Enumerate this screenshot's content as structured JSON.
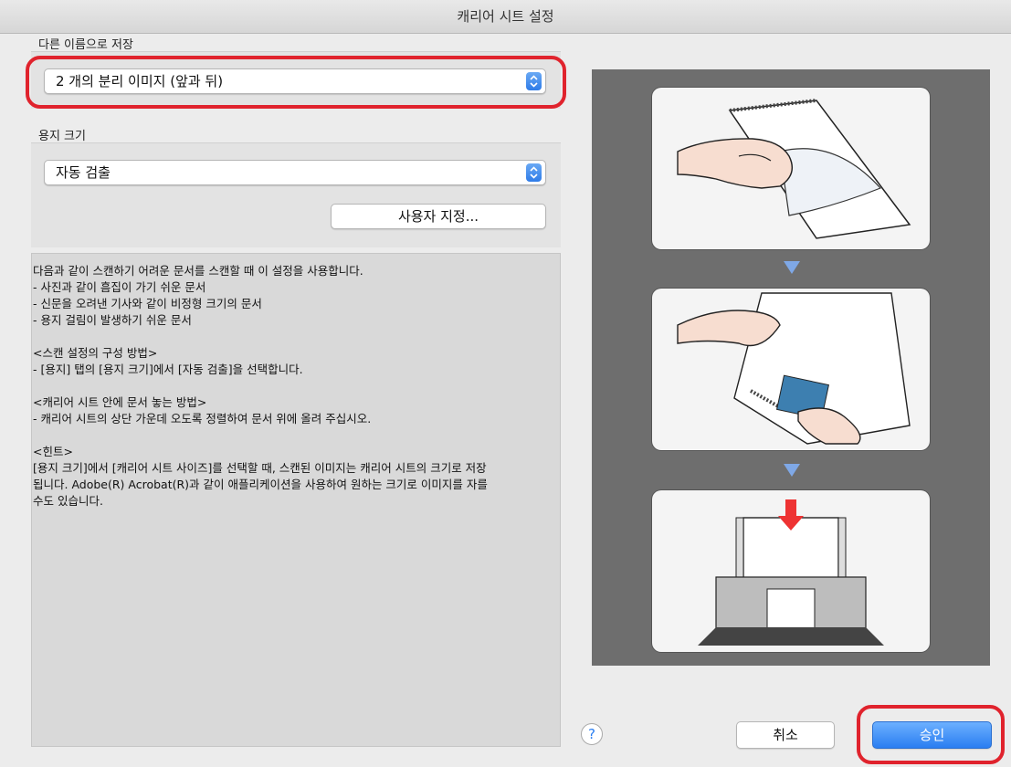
{
  "window": {
    "title": "캐리어 시트 설정"
  },
  "save_as": {
    "label": "다른 이름으로 저장",
    "selected": "2 개의 분리 이미지 (앞과 뒤)"
  },
  "paper_size": {
    "label": "용지 크기",
    "selected": "자동 검출",
    "custom_button": "사용자 지정..."
  },
  "description": {
    "lines": [
      "다음과 같이 스캔하기 어려운 문서를 스캔할 때 이 설정을 사용합니다.",
      "- 사진과 같이 흠집이 가기 쉬운 문서",
      "- 신문을 오려낸 기사와 같이 비정형 크기의 문서",
      "- 용지 걸림이 발생하기 쉬운 문서",
      "",
      "<스캔 설정의 구성 방법>",
      "- [용지] 탭의 [용지 크기]에서 [자동 검출]을 선택합니다.",
      "",
      "<캐리어 시트 안에 문서 놓는 방법>",
      "- 캐리어 시트의 상단 가운데 오도록 정렬하여 문서 위에 올려 주십시오.",
      "",
      "<힌트>",
      "[용지 크기]에서 [캐리어 시트 사이즈]를 선택할 때, 스캔된 이미지는 캐리어 시트의 크기로 저장",
      "됩니다. Adobe(R) Acrobat(R)과 같이 애플리케이션을 사용하여 원하는 크기로 이미지를 자를",
      "수도 있습니다."
    ]
  },
  "footer": {
    "help": "?",
    "cancel": "취소",
    "ok": "승인"
  },
  "colors": {
    "highlight": "#e0232d",
    "accent": "#2a7ef1",
    "arrow": "#7fa8e6"
  }
}
